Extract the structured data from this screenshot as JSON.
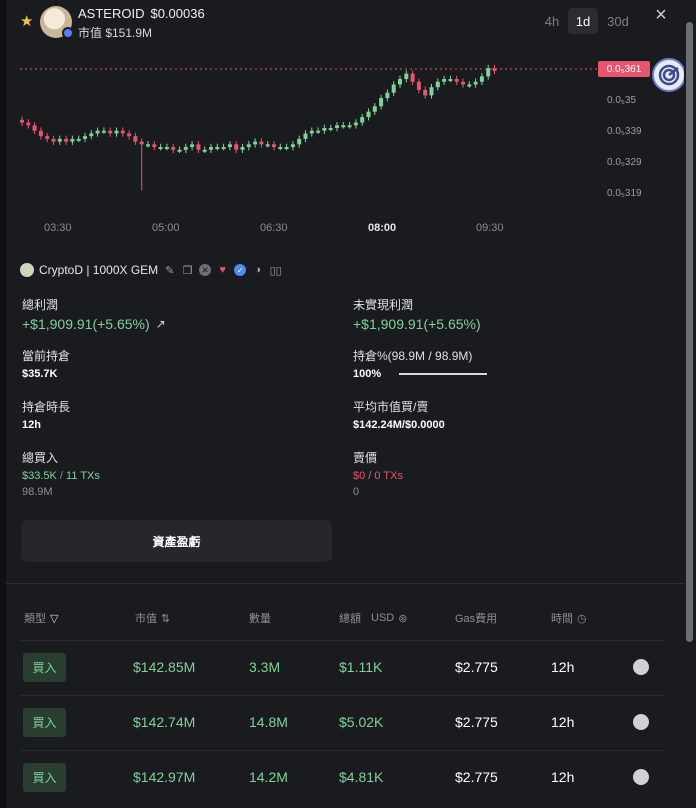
{
  "token": {
    "name": "ASTEROID",
    "price": "$0.00036",
    "market_cap": "市值 $151.9M"
  },
  "timeframes": [
    {
      "label": "4h"
    },
    {
      "label": "1d"
    },
    {
      "label": "30d"
    }
  ],
  "active_timeframe": "1d",
  "close_icon": "×",
  "chart": {
    "current_price_label": "0.0₅361",
    "y_labels": [
      "0.0₅35",
      "0.0₅339",
      "0.0₅329",
      "0.0₅319"
    ],
    "x_labels": [
      "03:30",
      "05:00",
      "06:30",
      "08:00",
      "09:30"
    ],
    "colors": {
      "up": "#7ed39a",
      "down": "#e8546e"
    }
  },
  "chart_data": {
    "type": "candlestick",
    "x_ticks": [
      "03:30",
      "05:00",
      "06:30",
      "08:00",
      "09:30"
    ],
    "y_ticks": [
      "0.0₅35",
      "0.0₅339",
      "0.0₅329",
      "0.0₅319"
    ],
    "last_price": "0.0₅361",
    "series": [
      {
        "close": [
          34.2,
          34.1,
          33.9,
          33.7,
          33.6,
          33.5,
          33.6,
          33.5,
          33.6,
          33.6,
          33.7,
          33.8,
          33.9,
          33.9,
          33.8,
          33.9,
          33.8,
          33.7,
          33.5,
          33.4,
          33.4,
          33.3,
          33.3,
          33.3,
          33.2,
          33.2,
          33.3,
          33.4,
          33.2,
          33.2,
          33.3,
          33.3,
          33.3,
          33.4,
          33.2,
          33.3,
          33.4,
          33.5,
          33.4,
          33.4,
          33.3,
          33.3,
          33.3,
          33.4,
          33.6,
          33.8,
          33.9,
          33.9,
          34.0,
          34.0,
          34.1,
          34.1,
          34.1,
          34.2,
          34.4,
          34.6,
          34.8,
          35.1,
          35.3,
          35.6,
          35.8,
          36.0,
          35.7,
          35.4,
          35.2,
          35.5,
          35.7,
          35.8,
          35.8,
          35.7,
          35.6,
          35.6,
          35.7,
          35.9,
          36.2,
          36.1
        ]
      }
    ]
  },
  "wallet": {
    "name": "CryptoD | 1000X GEM"
  },
  "stats": {
    "total_profit_label": "總利潤",
    "total_profit_value": "+$1,909.91(+5.65%)",
    "unrealized_label": "未實現利潤",
    "unrealized_value": "+$1,909.91(+5.65%)",
    "holding_label": "當前持倉",
    "holding_value": "$35.7K",
    "hold_pct_label": "持倉%(98.9M / 98.9M)",
    "hold_pct_value": "100%",
    "hold_pct_fraction": 1.0,
    "duration_label": "持倉時長",
    "duration_value": "12h",
    "avg_mc_label": "平均市值買/賣",
    "avg_mc_value": "$142.24M/$0.0000",
    "total_buy_label": "總買入",
    "total_buy_amount": "$33.5K",
    "total_buy_sep": " / ",
    "total_buy_txs": "11 TXs",
    "total_buy_qty": "98.9M",
    "sell_label": "賣價",
    "sell_amount": "$0",
    "sell_sep": " / ",
    "sell_txs": "0 TXs",
    "sell_qty": "0"
  },
  "pnl_button": "資產盈虧",
  "table": {
    "headers": {
      "type": "類型",
      "mcap": "市值",
      "qty": "數量",
      "total": "總額",
      "usd": "USD",
      "gas": "Gas費用",
      "time": "時間"
    },
    "rows": [
      {
        "type": "買入",
        "mcap": "$142.85M",
        "qty": "3.3M",
        "total": "$1.11K",
        "gas": "$2.775",
        "time": "12h"
      },
      {
        "type": "買入",
        "mcap": "$142.74M",
        "qty": "14.8M",
        "total": "$5.02K",
        "gas": "$2.775",
        "time": "12h"
      },
      {
        "type": "買入",
        "mcap": "$142.97M",
        "qty": "14.2M",
        "total": "$4.81K",
        "gas": "$2.775",
        "time": "12h"
      }
    ]
  }
}
